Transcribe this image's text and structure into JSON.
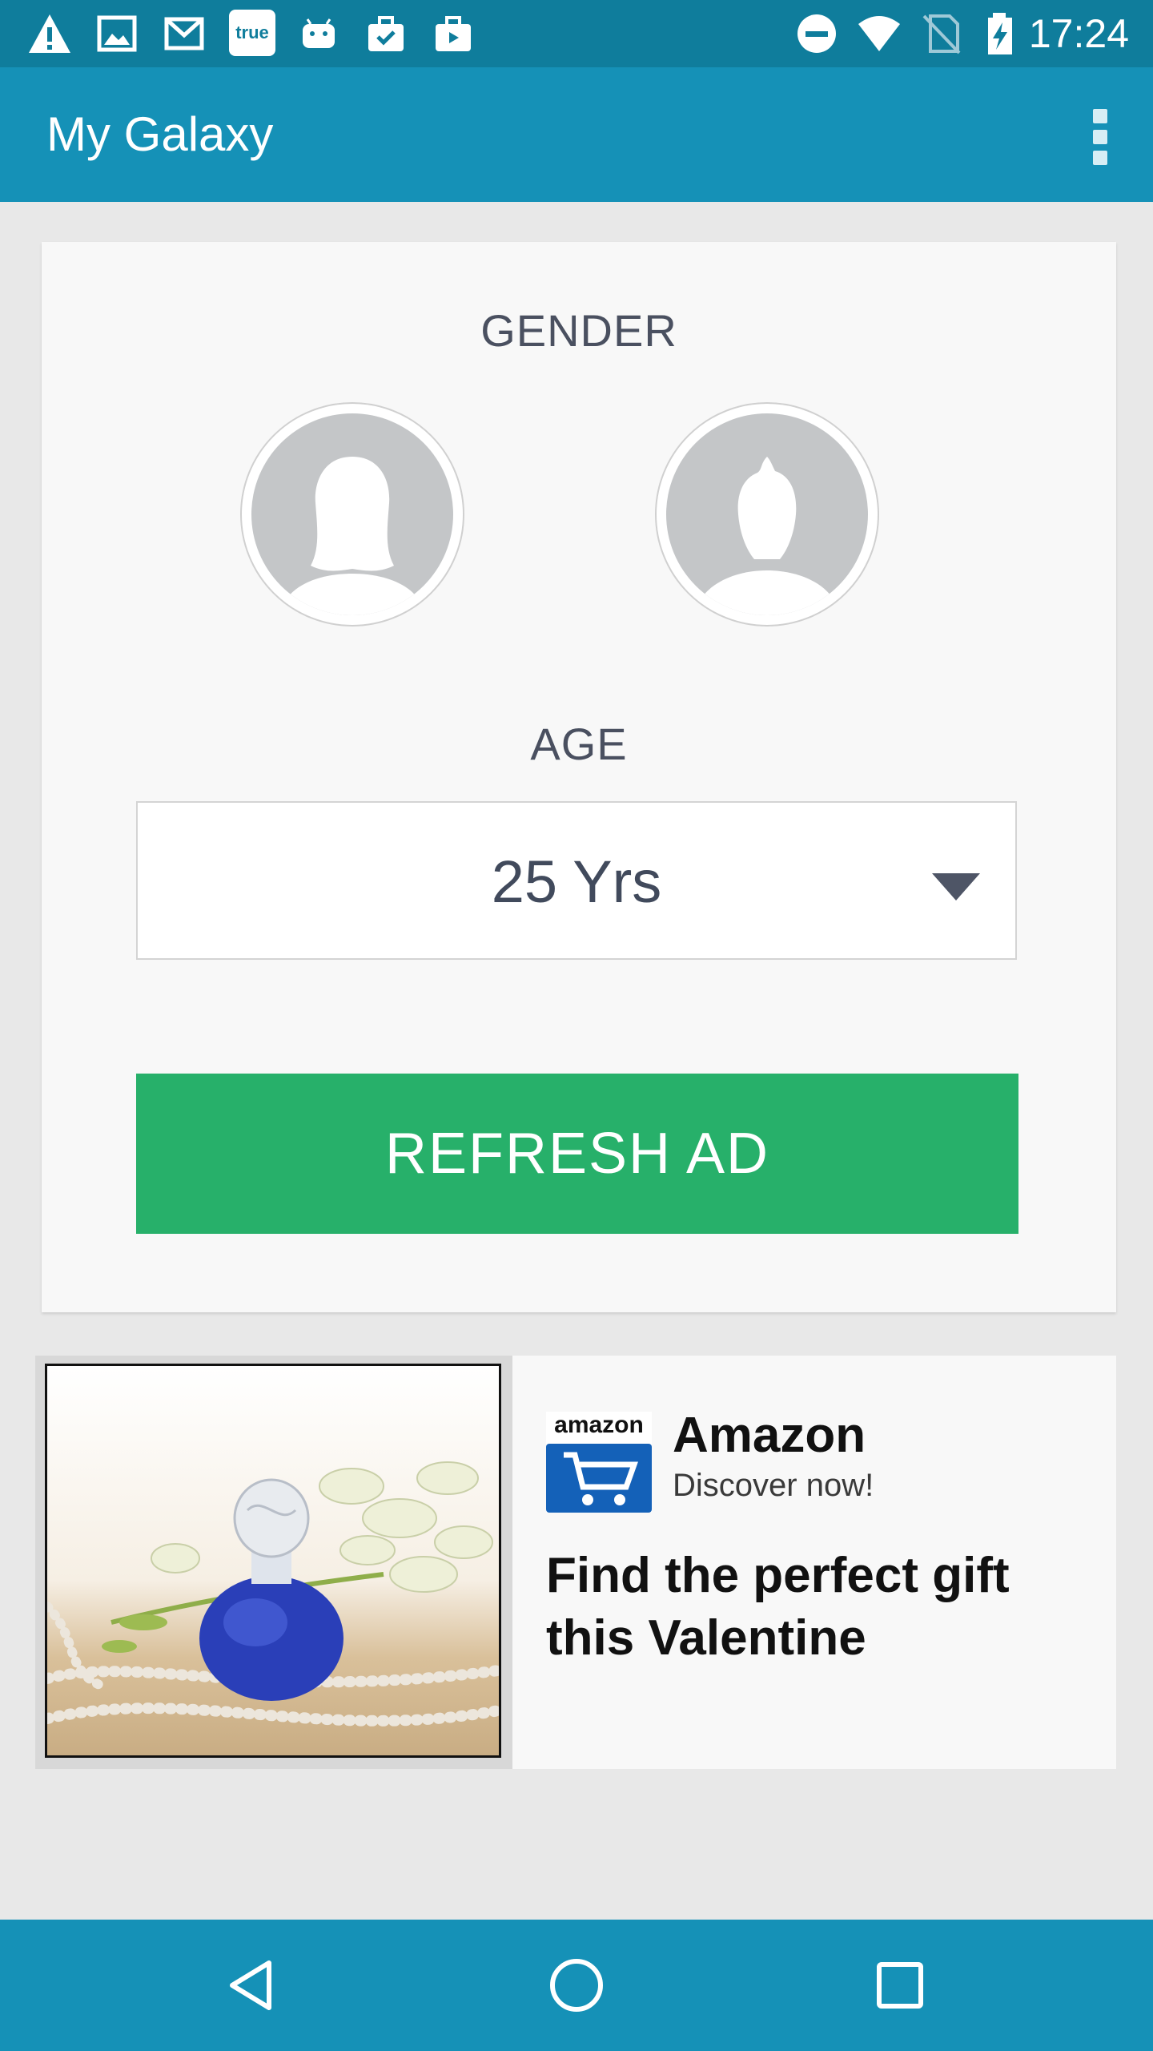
{
  "status_bar": {
    "time": "17:24",
    "left_icons": [
      "warning-icon",
      "image-icon",
      "gmail-icon",
      "true-app-icon",
      "android-icon",
      "task-check-icon",
      "briefcase-icon"
    ],
    "right_icons": [
      "do-not-disturb-icon",
      "wifi-icon",
      "no-sim-icon",
      "battery-charging-icon"
    ],
    "true_label": "true"
  },
  "app_bar": {
    "title": "My Galaxy",
    "menu_icon": "overflow-menu-icon"
  },
  "form": {
    "gender_label": "GENDER",
    "gender_options": [
      "female-avatar",
      "male-avatar"
    ],
    "age_label": "AGE",
    "age_value": "25 Yrs",
    "refresh_label": "REFRESH AD"
  },
  "ad": {
    "logo_text": "amazon",
    "brand": "Amazon",
    "tagline": "Discover now!",
    "headline": "Find the perfect gift this Valentine"
  },
  "nav_bar": {
    "buttons": [
      "back-icon",
      "home-icon",
      "recents-icon"
    ]
  },
  "colors": {
    "status_bar": "#0f7d9c",
    "app_bar": "#1591b7",
    "button_green": "#27b06a",
    "background": "#e8e8e8"
  }
}
